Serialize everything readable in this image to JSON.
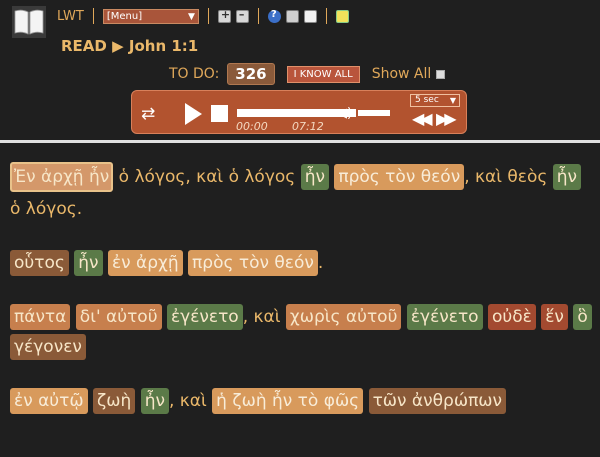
{
  "toolbar": {
    "app_name": "LWT",
    "menu_select": "[Menu]"
  },
  "read": {
    "label": "READ",
    "arrow": "▶",
    "title": "John 1:1"
  },
  "status": {
    "todo_label": "TO DO:",
    "todo_count": "326",
    "iknowall_label": "I KNOW ALL",
    "showall_label": "Show All"
  },
  "player": {
    "current_time": "00:00",
    "duration": "07:12",
    "speed": "5 sec"
  },
  "text": {
    "paragraphs": [
      [
        {
          "t": "Ἐν ἀρχῇ ἦν",
          "s": "s0"
        },
        {
          "t": " ὁ λόγος, καὶ ὁ λόγος ",
          "s": "plain"
        },
        {
          "t": "ἦν",
          "s": "s4"
        },
        {
          "t": " ",
          "s": "plain"
        },
        {
          "t": "πρὸς τὸν θεόν",
          "s": "s3"
        },
        {
          "t": ", καὶ θεὸς ",
          "s": "plain"
        },
        {
          "t": "ἦν",
          "s": "s4"
        },
        {
          "t": " ὁ λόγος.",
          "s": "plain"
        }
      ],
      [
        {
          "t": "οὗτος",
          "s": "s1"
        },
        {
          "t": " ",
          "s": "plain"
        },
        {
          "t": "ἦν",
          "s": "s4"
        },
        {
          "t": " ",
          "s": "plain"
        },
        {
          "t": "ἐν ἀρχῇ",
          "s": "s3"
        },
        {
          "t": " ",
          "s": "plain"
        },
        {
          "t": "πρὸς τὸν θεόν",
          "s": "s3"
        },
        {
          "t": ".",
          "s": "plain"
        }
      ],
      [
        {
          "t": "πάντα",
          "s": "s2"
        },
        {
          "t": " ",
          "s": "plain"
        },
        {
          "t": "δι' αὐτοῦ",
          "s": "s2"
        },
        {
          "t": " ",
          "s": "plain"
        },
        {
          "t": "ἐγένετο",
          "s": "s4"
        },
        {
          "t": ", καὶ ",
          "s": "plain"
        },
        {
          "t": "χωρὶς αὐτοῦ",
          "s": "s2"
        },
        {
          "t": " ",
          "s": "plain"
        },
        {
          "t": "ἐγένετο",
          "s": "s4"
        },
        {
          "t": " ",
          "s": "plain"
        },
        {
          "t": "οὐδὲ",
          "s": "sdark"
        },
        {
          "t": " ",
          "s": "plain"
        },
        {
          "t": "ἕν",
          "s": "sdark"
        },
        {
          "t": " ",
          "s": "plain"
        },
        {
          "t": "ὃ",
          "s": "s4"
        },
        {
          "t": " ",
          "s": "plain"
        },
        {
          "t": "γέγονεν",
          "s": "s1"
        }
      ],
      [
        {
          "t": "ἐν αὐτῷ",
          "s": "s3"
        },
        {
          "t": " ",
          "s": "plain"
        },
        {
          "t": "ζωὴ",
          "s": "s1"
        },
        {
          "t": " ",
          "s": "plain"
        },
        {
          "t": "ἦν",
          "s": "s4"
        },
        {
          "t": ", καὶ ",
          "s": "plain"
        },
        {
          "t": "ἡ ζωὴ ἦν τὸ φῶς",
          "s": "s3"
        },
        {
          "t": " ",
          "s": "plain"
        },
        {
          "t": "τῶν ἀνθρώπων",
          "s": "s1"
        }
      ]
    ]
  }
}
